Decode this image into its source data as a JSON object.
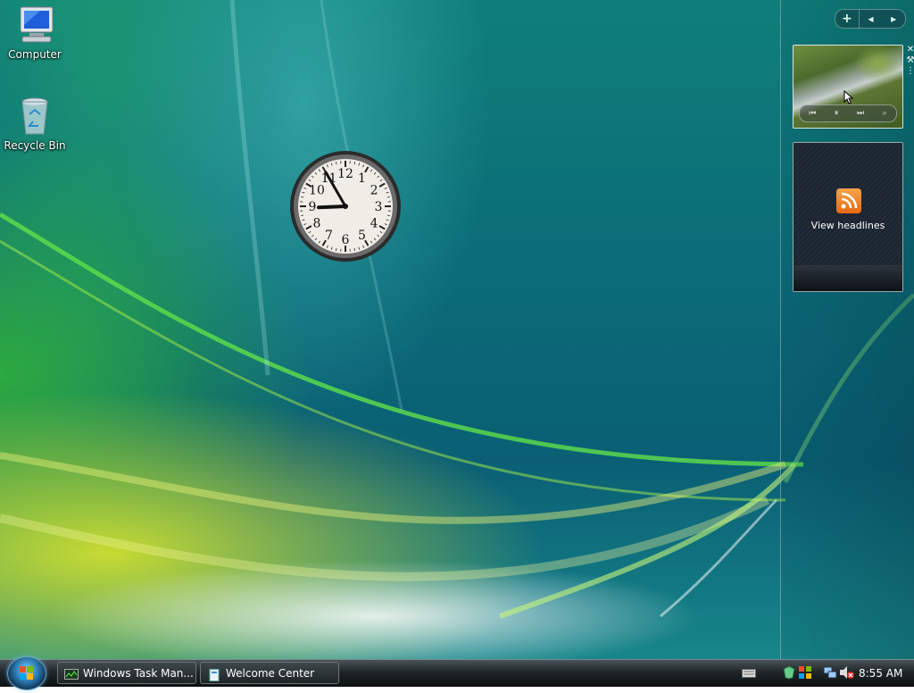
{
  "desktop": {
    "icons": [
      {
        "label": "Computer",
        "icon": "computer-icon"
      },
      {
        "label": "Recycle Bin",
        "icon": "recycle-bin-icon"
      }
    ]
  },
  "clock_gadget": {
    "numbers": [
      "12",
      "1",
      "2",
      "3",
      "4",
      "5",
      "6",
      "7",
      "8",
      "9",
      "10",
      "11"
    ],
    "time": {
      "hour": 8,
      "minute": 55
    }
  },
  "sidebar": {
    "controls": {
      "add": "+",
      "prev": "◂",
      "next": "▸"
    },
    "slideshow": {
      "controls": [
        "⏮",
        "⏸",
        "⏭",
        "⌕"
      ]
    },
    "feed": {
      "label": "View headlines"
    }
  },
  "taskbar": {
    "tasks": [
      {
        "label": "Windows Task Man..."
      },
      {
        "label": "Welcome Center"
      }
    ],
    "tray": {
      "time": "8:55 AM"
    }
  }
}
